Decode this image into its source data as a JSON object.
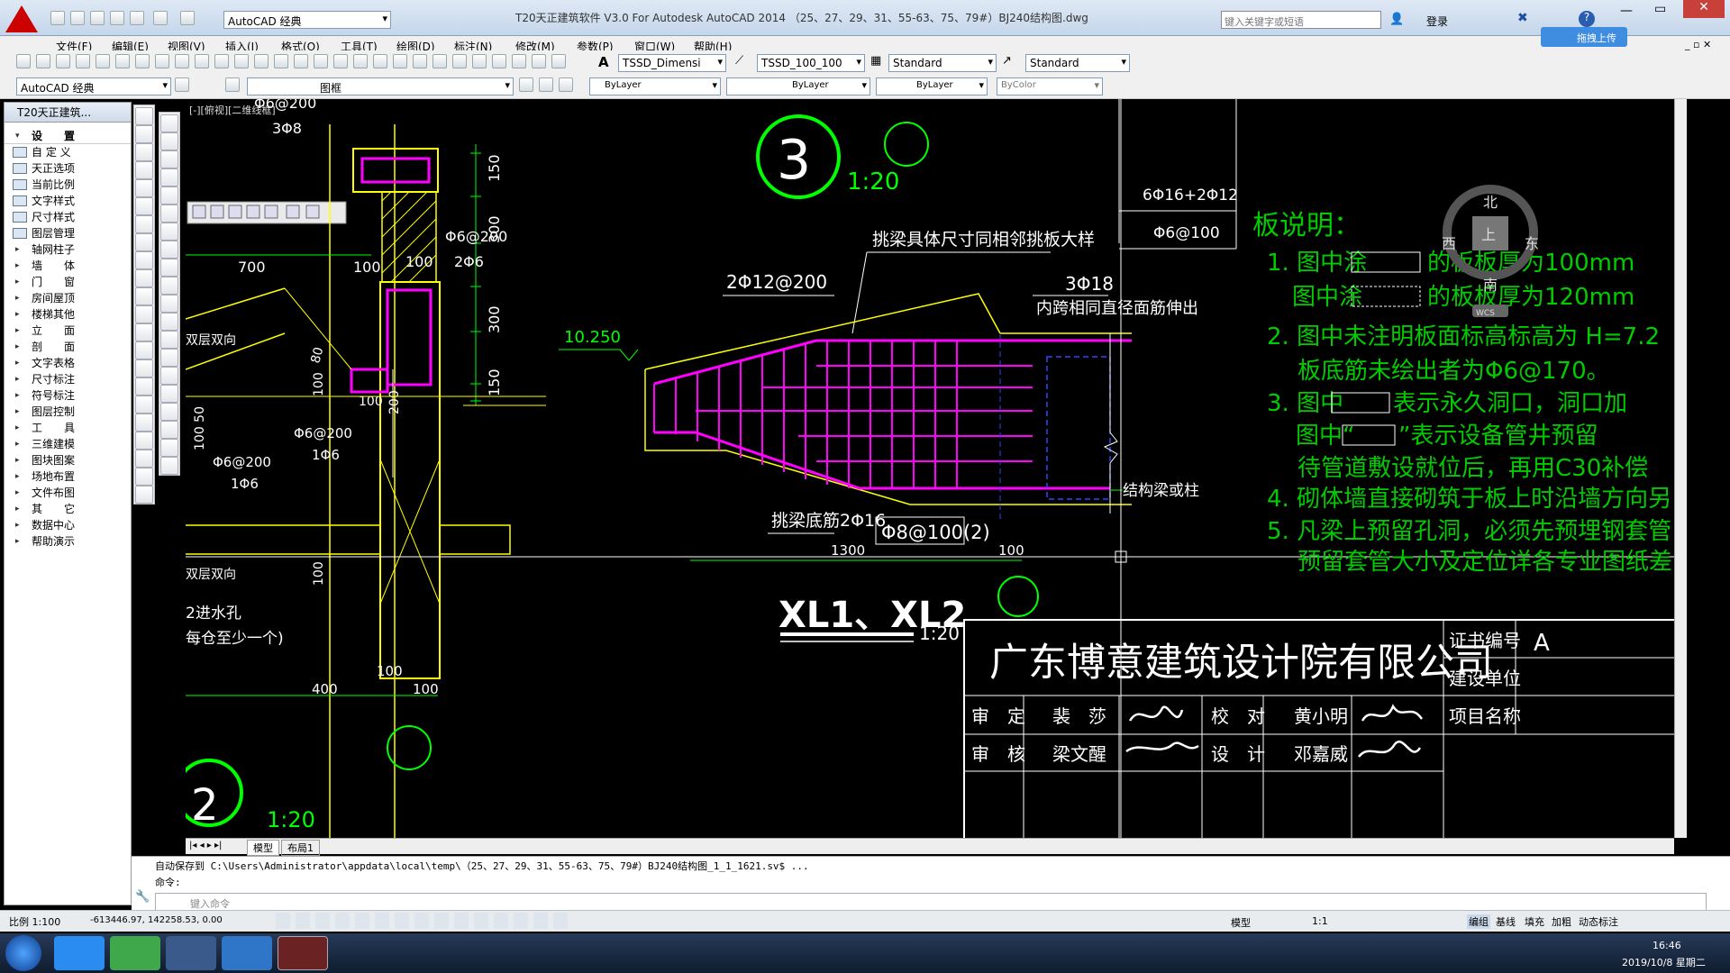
{
  "titlebar": {
    "window_title": "T20天正建筑软件 V3.0 For Autodesk AutoCAD 2014  （25、27、29、31、55-63、75、79#）BJ240结构图.dwg",
    "workspace": "AutoCAD 经典",
    "search_placeholder": "键入关键字或短语",
    "login": "登录",
    "upload": "拖拽上传"
  },
  "menus": [
    "文件(F)",
    "编辑(E)",
    "视图(V)",
    "插入(I)",
    "格式(O)",
    "工具(T)",
    "绘图(D)",
    "标注(N)",
    "修改(M)",
    "参数(P)",
    "窗口(W)",
    "帮助(H)"
  ],
  "styles": {
    "text_style": "TSSD_Dimensi",
    "dim_style": "TSSD_100_100",
    "table_style": "Standard",
    "mleader_style": "Standard"
  },
  "layers": {
    "workspace": "AutoCAD 经典",
    "layer": "图框",
    "color": "ByLayer",
    "linetype": "ByLayer",
    "lineweight": "ByLayer",
    "plotstyle": "ByColor"
  },
  "leftpanel": {
    "title": "T20天正建筑...",
    "items": [
      {
        "label": "设　　置",
        "type": "header"
      },
      {
        "label": "自 定 义",
        "type": "icon"
      },
      {
        "label": "天正选项",
        "type": "icon"
      },
      {
        "label": "当前比例",
        "type": "icon"
      },
      {
        "label": "文字样式",
        "type": "icon"
      },
      {
        "label": "尺寸样式",
        "type": "icon"
      },
      {
        "label": "图层管理",
        "type": "icon"
      },
      {
        "label": "轴网柱子",
        "type": "arrow"
      },
      {
        "label": "墙　　体",
        "type": "arrow"
      },
      {
        "label": "门　　窗",
        "type": "arrow"
      },
      {
        "label": "房间屋顶",
        "type": "arrow"
      },
      {
        "label": "楼梯其他",
        "type": "arrow"
      },
      {
        "label": "立　　面",
        "type": "arrow"
      },
      {
        "label": "剖　　面",
        "type": "arrow"
      },
      {
        "label": "文字表格",
        "type": "arrow"
      },
      {
        "label": "尺寸标注",
        "type": "arrow"
      },
      {
        "label": "符号标注",
        "type": "arrow"
      },
      {
        "label": "图层控制",
        "type": "arrow"
      },
      {
        "label": "工　　具",
        "type": "arrow"
      },
      {
        "label": "三维建模",
        "type": "arrow"
      },
      {
        "label": "图块图案",
        "type": "arrow"
      },
      {
        "label": "场地布置",
        "type": "arrow"
      },
      {
        "label": "文件布图",
        "type": "arrow"
      },
      {
        "label": "其　　它",
        "type": "arrow"
      },
      {
        "label": "数据中心",
        "type": "arrow"
      },
      {
        "label": "帮助演示",
        "type": "arrow"
      }
    ]
  },
  "viewport_label": "[-][俯视][二维线框]",
  "drawing": {
    "detail3": "3",
    "scale3": "1:20",
    "left": {
      "t1": "Φ6@200",
      "t2": "3Φ8",
      "t3": "700",
      "t4": "100",
      "t5": "100",
      "t6": "Φ6@200",
      "t7": "2Φ6",
      "t8": "150",
      "t9": "300",
      "t10": "300",
      "t11": "150",
      "t12": "双层双向",
      "t13": "100",
      "t14": "100",
      "t15": "200",
      "t16": "100 50",
      "t17": "Φ6@200",
      "t18": "1Φ6",
      "t19": "Φ6@200",
      "t20": "1Φ6",
      "t21": "100",
      "t22": "双层双向",
      "t23": "2进水孔",
      "t24": "每仓至少一个)",
      "t25": "400",
      "t26": "100",
      "t27": "100",
      "t28": "80"
    },
    "beam": {
      "note1": "挑梁具体尺寸同相邻挑板大样",
      "rebar_top": "2Φ12@200",
      "rebar_right": "3Φ18",
      "note2": "内跨相同直径面筋伸出",
      "elev": "10.250",
      "bottom": "挑梁底筋2Φ16",
      "stirrup": "Φ8@100(2)",
      "dim1": "1300",
      "dim2": "100",
      "col": "结构梁或柱"
    },
    "title2": "XL1、XL2",
    "scale2": "1:20",
    "detail2": "2",
    "scale_bottom": "1:20",
    "schedule": {
      "r1": "6Φ16+2Φ12",
      "r2": "Φ6@100"
    },
    "notes": {
      "title": "板说明：",
      "n1a": "1. 图中涂",
      "n1b": "的板板厚为100mm",
      "n1c": "图中涂",
      "n1d": "的板板厚为120mm",
      "n2a": "2. 图中未注明板面标高标高为 H=7.2",
      "n2b": "板底筋未绘出者为Φ6@170。",
      "n3a": "3. 图中",
      "n3b": "表示永久洞口，洞口加",
      "n3c": "图中“",
      "n3d": "”表示设备管井预留",
      "n3e": "待管道敷设就位后，再用C30补偿",
      "n4": "4. 砌体墙直接砌筑于板上时沿墙方向另",
      "n5a": "5. 凡梁上预留孔洞，必须先预埋钢套管",
      "n5b": "预留套管大小及定位详各专业图纸差"
    },
    "titleblock": {
      "company": "广东博意建筑设计院有限公司",
      "cert": "证书编号",
      "client": "建设单位",
      "project": "项目名称",
      "approve": "审　定",
      "approver": "裴　莎",
      "check": "校　对",
      "checker": "黄小明",
      "review": "审　核",
      "reviewer": "梁文醒",
      "design": "设　计",
      "designer": "邓嘉威",
      "partial": "A"
    },
    "compass": {
      "n": "北",
      "s": "南",
      "w": "西",
      "e": "东",
      "top": "上",
      "wcs": "WCS"
    }
  },
  "tabs": [
    "模型",
    "布局1"
  ],
  "command": {
    "history": "自动保存到 C:\\Users\\Administrator\\appdata\\local\\temp\\（25、27、29、31、55-63、75、79#）BJ240结构图_1_1_1621.sv$ ...",
    "prompt": "命令:",
    "placeholder": "键入命令"
  },
  "status": {
    "scale": "比例 1:100",
    "coords": "-613446.97, 142258.53, 0.00",
    "model": "模型",
    "annoscale": "1:1",
    "b1": "编组",
    "b2": "基线",
    "b3": "填充",
    "b4": "加粗",
    "b5": "动态标注"
  },
  "taskbar": {
    "time": "16:46",
    "date": "2019/10/8 星期二"
  },
  "colors": {
    "green": "#00ff00",
    "magenta": "#ff00ff",
    "yellow": "#ffff00",
    "white": "#ffffff",
    "bg": "#000000"
  }
}
